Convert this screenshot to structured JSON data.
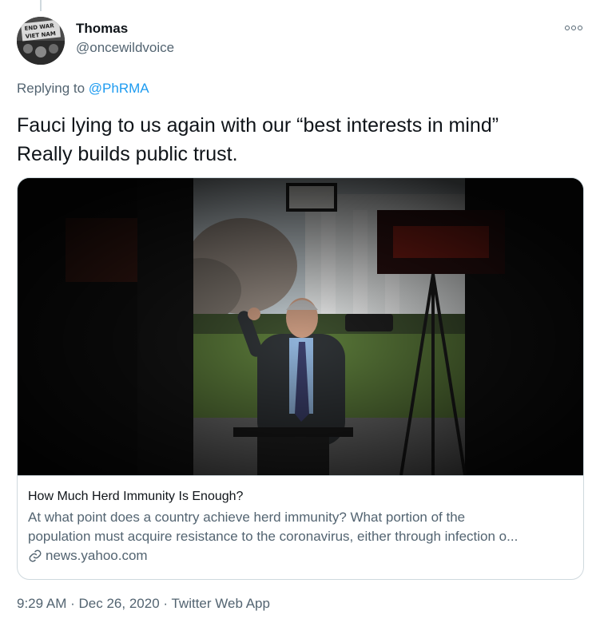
{
  "author": {
    "display_name": "Thomas",
    "handle": "@oncewildvoice",
    "avatar_sign_text": "END WAR VIET NAM"
  },
  "reply": {
    "prefix": "Replying to",
    "mention": "@PhRMA"
  },
  "tweet": {
    "line1": "Fauci lying to us again with our “best interests in mind”",
    "line2": "Really builds public trust."
  },
  "card": {
    "image_description_icon": "news-photo",
    "title": "How Much Herd Immunity Is Enough?",
    "description_line1": "At what point does a country achieve herd immunity? What portion of the",
    "description_line2": "population must acquire resistance to the coronavirus, either through infection o...",
    "domain": "news.yahoo.com"
  },
  "meta": {
    "time": "9:29 AM",
    "separator": "·",
    "date": "Dec 26, 2020",
    "source": "Twitter Web App"
  },
  "colors": {
    "link": "#1d9bf0",
    "secondary_text": "#536471",
    "border": "#cfd9de"
  }
}
